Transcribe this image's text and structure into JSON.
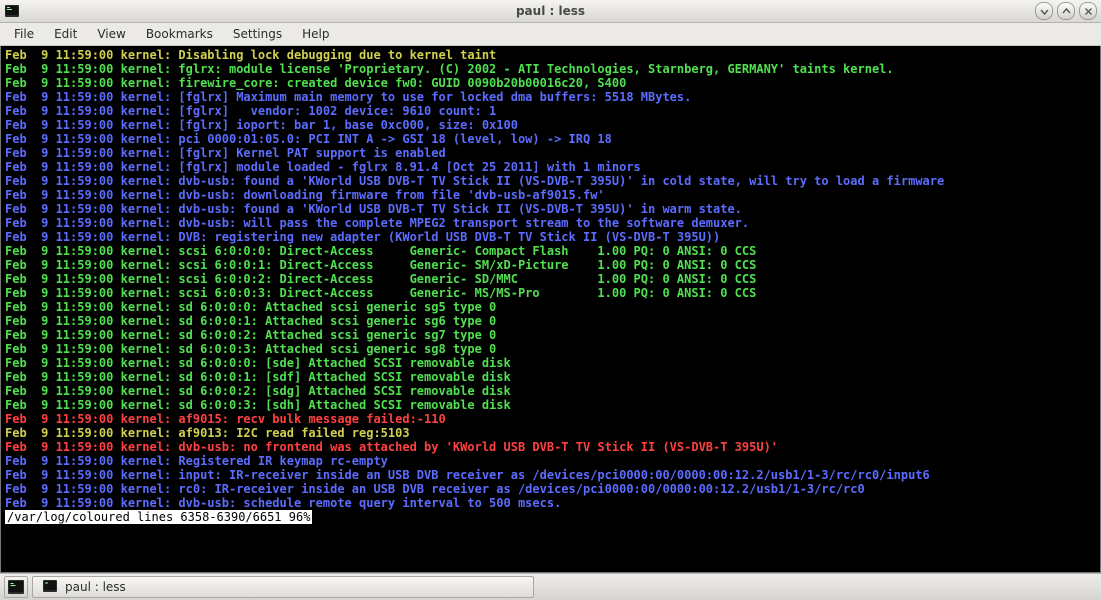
{
  "window": {
    "title": "paul : less"
  },
  "menu": {
    "items": [
      "File",
      "Edit",
      "View",
      "Bookmarks",
      "Settings",
      "Help"
    ]
  },
  "log": {
    "lines": [
      {
        "color": "yellow",
        "text": "Feb  9 11:59:00 kernel: Disabling lock debugging due to kernel taint"
      },
      {
        "color": "green",
        "text": "Feb  9 11:59:00 kernel: fglrx: module license 'Proprietary. (C) 2002 - ATI Technologies, Starnberg, GERMANY' taints kernel."
      },
      {
        "color": "green",
        "text": "Feb  9 11:59:00 kernel: firewire_core: created device fw0: GUID 0090b20b00016c20, S400"
      },
      {
        "color": "blue",
        "text": "Feb  9 11:59:00 kernel: [fglrx] Maximum main memory to use for locked dma buffers: 5518 MBytes."
      },
      {
        "color": "blue",
        "text": "Feb  9 11:59:00 kernel: [fglrx]   vendor: 1002 device: 9610 count: 1"
      },
      {
        "color": "blue",
        "text": "Feb  9 11:59:00 kernel: [fglrx] ioport: bar 1, base 0xc000, size: 0x100"
      },
      {
        "color": "blue",
        "text": "Feb  9 11:59:00 kernel: pci 0000:01:05.0: PCI INT A -> GSI 18 (level, low) -> IRQ 18"
      },
      {
        "color": "blue",
        "text": "Feb  9 11:59:00 kernel: [fglrx] Kernel PAT support is enabled"
      },
      {
        "color": "blue",
        "text": "Feb  9 11:59:00 kernel: [fglrx] module loaded - fglrx 8.91.4 [Oct 25 2011] with 1 minors"
      },
      {
        "color": "blue",
        "text": "Feb  9 11:59:00 kernel: dvb-usb: found a 'KWorld USB DVB-T TV Stick II (VS-DVB-T 395U)' in cold state, will try to load a firmware"
      },
      {
        "color": "blue",
        "text": "Feb  9 11:59:00 kernel: dvb-usb: downloading firmware from file 'dvb-usb-af9015.fw'"
      },
      {
        "color": "blue",
        "text": "Feb  9 11:59:00 kernel: dvb-usb: found a 'KWorld USB DVB-T TV Stick II (VS-DVB-T 395U)' in warm state."
      },
      {
        "color": "blue",
        "text": "Feb  9 11:59:00 kernel: dvb-usb: will pass the complete MPEG2 transport stream to the software demuxer."
      },
      {
        "color": "blue",
        "text": "Feb  9 11:59:00 kernel: DVB: registering new adapter (KWorld USB DVB-T TV Stick II (VS-DVB-T 395U))"
      },
      {
        "color": "green",
        "text": "Feb  9 11:59:00 kernel: scsi 6:0:0:0: Direct-Access     Generic- Compact Flash    1.00 PQ: 0 ANSI: 0 CCS"
      },
      {
        "color": "green",
        "text": "Feb  9 11:59:00 kernel: scsi 6:0:0:1: Direct-Access     Generic- SM/xD-Picture    1.00 PQ: 0 ANSI: 0 CCS"
      },
      {
        "color": "green",
        "text": "Feb  9 11:59:00 kernel: scsi 6:0:0:2: Direct-Access     Generic- SD/MMC           1.00 PQ: 0 ANSI: 0 CCS"
      },
      {
        "color": "green",
        "text": "Feb  9 11:59:00 kernel: scsi 6:0:0:3: Direct-Access     Generic- MS/MS-Pro        1.00 PQ: 0 ANSI: 0 CCS"
      },
      {
        "color": "green",
        "text": "Feb  9 11:59:00 kernel: sd 6:0:0:0: Attached scsi generic sg5 type 0"
      },
      {
        "color": "green",
        "text": "Feb  9 11:59:00 kernel: sd 6:0:0:1: Attached scsi generic sg6 type 0"
      },
      {
        "color": "green",
        "text": "Feb  9 11:59:00 kernel: sd 6:0:0:2: Attached scsi generic sg7 type 0"
      },
      {
        "color": "green",
        "text": "Feb  9 11:59:00 kernel: sd 6:0:0:3: Attached scsi generic sg8 type 0"
      },
      {
        "color": "green",
        "text": "Feb  9 11:59:00 kernel: sd 6:0:0:0: [sde] Attached SCSI removable disk"
      },
      {
        "color": "green",
        "text": "Feb  9 11:59:00 kernel: sd 6:0:0:1: [sdf] Attached SCSI removable disk"
      },
      {
        "color": "green",
        "text": "Feb  9 11:59:00 kernel: sd 6:0:0:2: [sdg] Attached SCSI removable disk"
      },
      {
        "color": "green",
        "text": "Feb  9 11:59:00 kernel: sd 6:0:0:3: [sdh] Attached SCSI removable disk"
      },
      {
        "color": "red",
        "text": "Feb  9 11:59:00 kernel: af9015: recv bulk message failed:-110"
      },
      {
        "color": "yellow",
        "text": "Feb  9 11:59:00 kernel: af9013: I2C read failed reg:5103"
      },
      {
        "color": "red",
        "text": "Feb  9 11:59:00 kernel: dvb-usb: no frontend was attached by 'KWorld USB DVB-T TV Stick II (VS-DVB-T 395U)'"
      },
      {
        "color": "blue",
        "text": "Feb  9 11:59:00 kernel: Registered IR keymap rc-empty"
      },
      {
        "color": "blue",
        "text": "Feb  9 11:59:00 kernel: input: IR-receiver inside an USB DVB receiver as /devices/pci0000:00/0000:00:12.2/usb1/1-3/rc/rc0/input6"
      },
      {
        "color": "blue",
        "text": "Feb  9 11:59:00 kernel: rc0: IR-receiver inside an USB DVB receiver as /devices/pci0000:00/0000:00:12.2/usb1/1-3/rc/rc0"
      },
      {
        "color": "blue",
        "text": "Feb  9 11:59:00 kernel: dvb-usb: schedule remote query interval to 500 msecs."
      }
    ],
    "status": "/var/log/coloured lines 6358-6390/6651 96%"
  },
  "taskbar": {
    "entry_label": "paul : less"
  }
}
